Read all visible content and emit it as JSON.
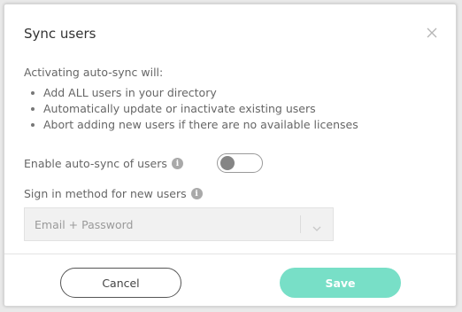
{
  "dialog": {
    "title": "Sync users",
    "intro": "Activating auto-sync will:",
    "bullets": [
      "Add ALL users in your directory",
      "Automatically update or inactivate existing users",
      "Abort adding new users if there are no available licenses"
    ],
    "auto_sync": {
      "label": "Enable auto-sync of users",
      "info_glyph": "i",
      "enabled": false
    },
    "sign_in": {
      "label": "Sign in method for new users",
      "info_glyph": "i",
      "selected": "Email + Password"
    },
    "cancel_label": "Cancel",
    "save_label": "Save"
  },
  "icons": {
    "close": "close-icon",
    "info": "info-icon",
    "chevron": "chevron-down-icon"
  },
  "colors": {
    "save_button": "#78dfc7",
    "toggle_knob": "#858585",
    "select_background": "#f1f1f1"
  }
}
